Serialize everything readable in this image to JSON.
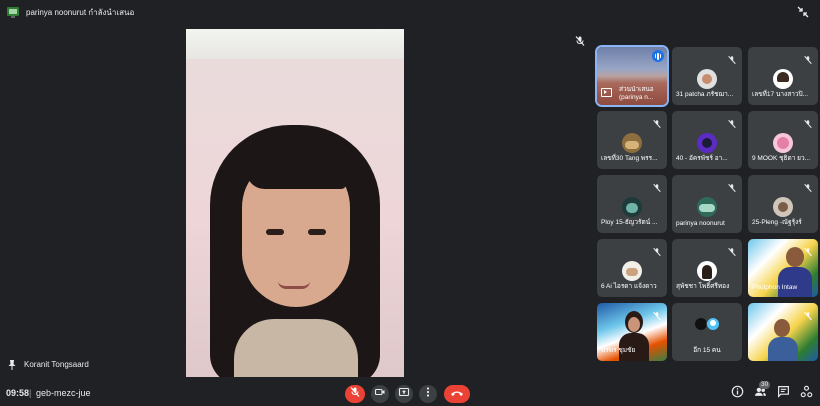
{
  "presenting_bar": {
    "text": "parinya noonurut กำลังนำเสนอ"
  },
  "main_video": {
    "name": "Koranit Tongsaard"
  },
  "tiles": [
    {
      "name": "ส่วนนำเสนอ (parinya n...",
      "speaking": true,
      "presenting": true
    },
    {
      "name": "31 patcha ภรัชฌา..."
    },
    {
      "name": "เลขที่17 นางสาวปิ..."
    },
    {
      "name": "เลขที่30 Tang พรร..."
    },
    {
      "name": "40 - อัครพัชร์ อา..."
    },
    {
      "name": "9 MOOK ชุธิดา ยว..."
    },
    {
      "name": "Ploy 15-ธัญวรัตน์ ..."
    },
    {
      "name": "parinya noonurut"
    },
    {
      "name": "25-Pleng -ณัฐรุ้งร์"
    },
    {
      "name": "6 Ai ไอรดา แจ้งดาว"
    },
    {
      "name": "สุพัชชา โพธิ์ศรีทอง"
    },
    {
      "name": "Phutphon Intaw"
    },
    {
      "name": "พรพร ชุมชัย"
    },
    {
      "name": "อีก 15 คน"
    },
    {
      "name": ""
    }
  ],
  "bottom_bar": {
    "time": "09:58",
    "separator": "|",
    "meeting_code": "geb-mezc-jue",
    "participant_count": "30"
  },
  "colors": {
    "background": "#202124",
    "tile": "#3c4043",
    "end_call": "#ea4335",
    "mic_off": "#ea4335",
    "accent": "#8ab4f8"
  },
  "icons": {
    "presenting": "present-screen-icon",
    "collapse": "collapse-icon",
    "main_pin": "pin-icon",
    "mic_off": "mic-off-icon",
    "camera": "camera-icon",
    "present": "present-now-icon",
    "more": "more-options-icon",
    "end_call": "end-call-icon",
    "info": "info-icon",
    "people": "people-icon",
    "chat": "chat-icon",
    "activities": "activities-icon"
  }
}
